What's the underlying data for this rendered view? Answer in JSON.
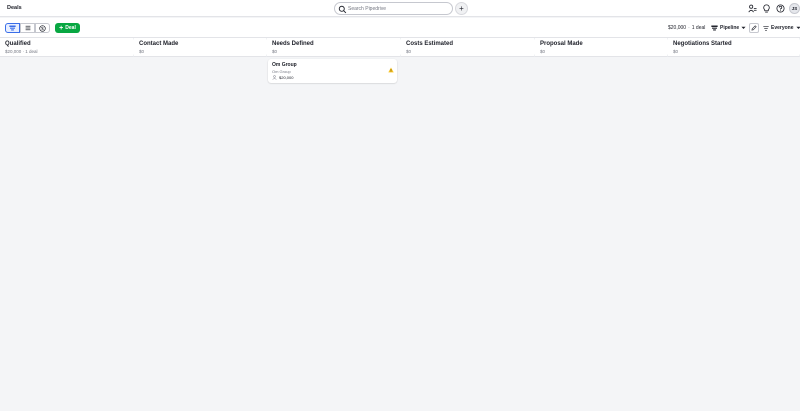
{
  "header": {
    "title": "Deals",
    "search_placeholder": "Search Pipedrive",
    "quick_add_label": "+",
    "avatar_initials": "JS"
  },
  "toolbar": {
    "add_deal_label": "Deal",
    "summary_value": "$20,000",
    "summary_separator": "·",
    "summary_count": "1 deal",
    "pipeline_label": "Pipeline",
    "owner_label": "Everyone"
  },
  "stages": [
    {
      "name": "Qualified",
      "meta": "$20,000 · 1 deal"
    },
    {
      "name": "Contact Made",
      "meta": "$0"
    },
    {
      "name": "Needs Defined",
      "meta": "$0"
    },
    {
      "name": "Costs Estimated",
      "meta": "$0"
    },
    {
      "name": "Proposal Made",
      "meta": "$0"
    },
    {
      "name": "Negotiations Started",
      "meta": "$0"
    }
  ],
  "deal": {
    "title": "Om Group",
    "organization": "Om Group",
    "value": "$20,000"
  },
  "colors": {
    "accent": "#08a742",
    "warning": "#f7c325",
    "active_view": "#3a6ee8"
  }
}
